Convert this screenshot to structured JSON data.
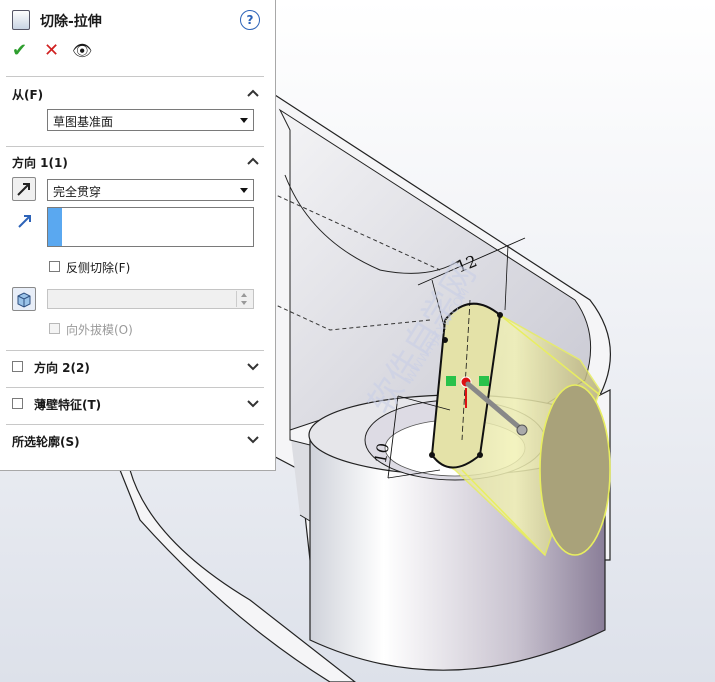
{
  "panel": {
    "title": "切除-拉伸",
    "help": "?",
    "actions": {
      "ok": "✔",
      "cancel": "✕",
      "preview": "👁"
    },
    "from": {
      "header": "从(F)",
      "value": "草图基准面"
    },
    "direction1": {
      "header": "方向 1(1)",
      "end_condition": "完全贯穿",
      "flip_side_label": "反侧切除(F)",
      "draft_outward_label": "向外拔模(O)"
    },
    "direction2": {
      "header": "方向 2(2)"
    },
    "thin_feature": {
      "header": "薄壁特征(T)"
    },
    "selected_contours": {
      "header": "所选轮廓(S)"
    }
  },
  "viewport": {
    "dimension_width": "12",
    "dimension_height": "10",
    "watermark": "软件自学网",
    "watermark_url": "WWW.RJZXW.COM"
  },
  "colors": {
    "accent_blue": "#2d63b8",
    "ok_green": "#2e9e2e",
    "cancel_red": "#d02020",
    "preview_yellow": "#e8ee60"
  }
}
